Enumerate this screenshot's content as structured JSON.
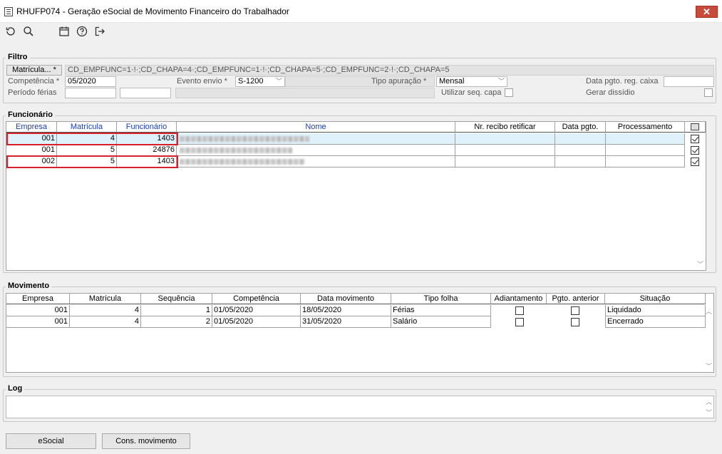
{
  "window": {
    "title": "RHUFP074 - Geração eSocial de Movimento Financeiro do Trabalhador",
    "close_glyph": "✕"
  },
  "toolbar": {
    "icons": [
      "refresh-icon",
      "search-icon",
      "calendar-icon",
      "help-icon",
      "exit-icon"
    ]
  },
  "filtro": {
    "label": "Filtro",
    "matricula_button": "Matrícula... *",
    "matricula_value": "CD_EMPFUNC=1·!·;CD_CHAPA=4·;CD_EMPFUNC=1·!·;CD_CHAPA=5·;CD_EMPFUNC=2·!·;CD_CHAPA=5",
    "competencia_label": "Competência *",
    "competencia_value": "05/2020",
    "evento_label": "Evento envio *",
    "evento_value": "S-1200",
    "tipo_apuracao_label": "Tipo apuração *",
    "tipo_apuracao_value": "Mensal",
    "data_pgto_label": "Data pgto. reg. caixa",
    "periodo_ferias_label": "Período férias",
    "utilizar_seq_label": "Utilizar seq. capa",
    "gerar_dissidio_label": "Gerar dissídio"
  },
  "funcionario": {
    "label": "Funcionário",
    "columns": [
      "Empresa",
      "Matrícula",
      "Funcionário",
      "Nome",
      "Nr. recibo retificar",
      "Data pgto.",
      "Processamento"
    ],
    "rows": [
      {
        "empresa": "001",
        "matricula": "4",
        "funcionario": "1403",
        "checked": true
      },
      {
        "empresa": "001",
        "matricula": "5",
        "funcionario": "24876",
        "checked": true
      },
      {
        "empresa": "002",
        "matricula": "5",
        "funcionario": "1403",
        "checked": true
      }
    ]
  },
  "movimento": {
    "label": "Movimento",
    "columns": [
      "Empresa",
      "Matrícula",
      "Sequência",
      "Competência",
      "Data movimento",
      "Tipo folha",
      "Adiantamento",
      "Pgto. anterior",
      "Situação"
    ],
    "rows": [
      {
        "empresa": "001",
        "matricula": "4",
        "sequencia": "1",
        "competencia": "01/05/2020",
        "data_movimento": "18/05/2020",
        "tipo_folha": "Férias",
        "situacao": "Liquidado"
      },
      {
        "empresa": "001",
        "matricula": "4",
        "sequencia": "2",
        "competencia": "01/05/2020",
        "data_movimento": "31/05/2020",
        "tipo_folha": "Salário",
        "situacao": "Encerrado"
      }
    ]
  },
  "log": {
    "label": "Log"
  },
  "footer": {
    "esocial_button": "eSocial",
    "cons_movimento_button": "Cons. movimento"
  },
  "colors": {
    "highlight_box": "#d9202a",
    "selected_row": "#dff1fb",
    "header_blue": "#1c3faa"
  }
}
